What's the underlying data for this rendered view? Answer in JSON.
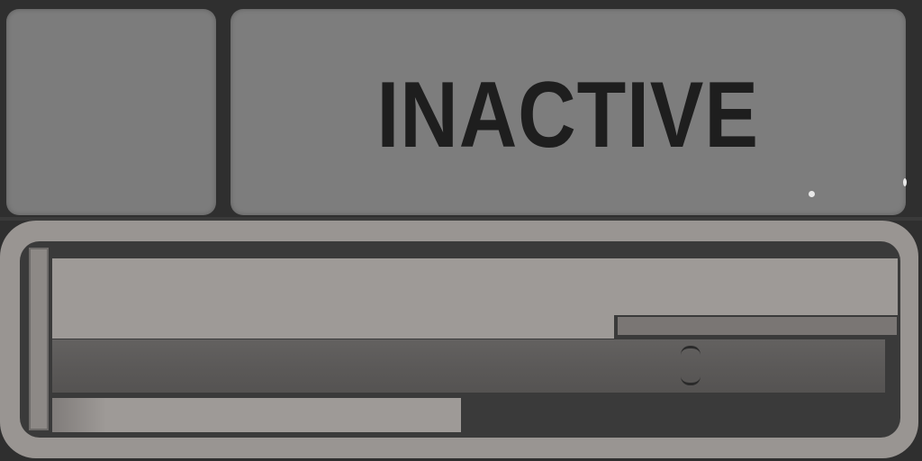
{
  "status_panel": {
    "status_label": "INACTIVE"
  }
}
